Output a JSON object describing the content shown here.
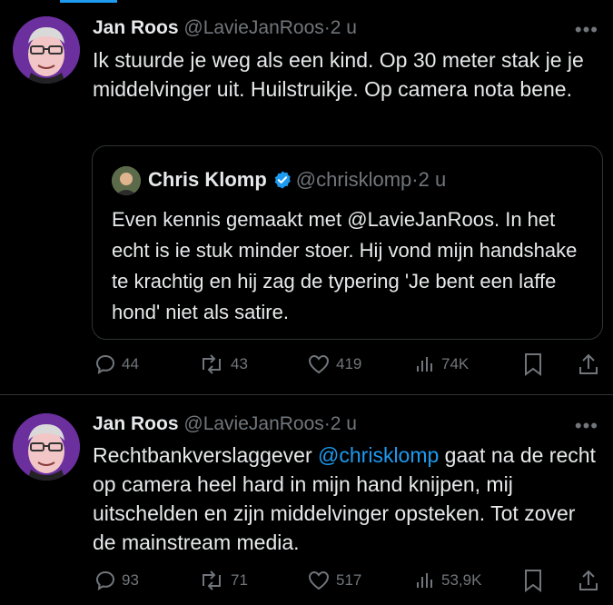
{
  "tweets": [
    {
      "author_name": "Jan Roos",
      "author_handle": "@LavieJanRoos",
      "time": "2 u",
      "text": "Ik stuurde je weg als een kind. Op 30 meter stak je je middelvinger uit. Huilstruikje. Op camera nota bene.",
      "quote": {
        "author_name": "Chris Klomp",
        "author_handle": "@chrisklomp",
        "time": "2 u",
        "text": "Even kennis gemaakt met @LavieJanRoos. In het echt is ie stuk minder stoer. Hij vond mijn handshake te krachtig en hij zag de typering 'Je bent een laffe hond' niet als satire."
      },
      "replies": "44",
      "reposts": "43",
      "likes": "419",
      "views": "74K"
    },
    {
      "author_name": "Jan Roos",
      "author_handle": "@LavieJanRoos",
      "time": "2 u",
      "text_prefix": "Rechtbankverslaggever ",
      "text_mention": "@chrisklomp",
      "text_suffix": " gaat na de recht op camera heel hard in mijn hand knijpen, mij uitschelden en zijn middelvinger opsteken. Tot zover de mainstream media.",
      "replies": "93",
      "reposts": "71",
      "likes": "517",
      "views": "53,9K"
    }
  ],
  "separator": "·",
  "more_icon": "•••",
  "colors": {
    "background": "#000000",
    "text": "#e7e9ea",
    "muted": "#71767b",
    "accent": "#1d9bf0",
    "border": "#2f3336",
    "avatar_bg": "#6b2f9e"
  },
  "icons": [
    "more-icon",
    "reply-icon",
    "repost-icon",
    "like-icon",
    "views-icon",
    "bookmark-icon",
    "share-icon",
    "verified-icon"
  ]
}
